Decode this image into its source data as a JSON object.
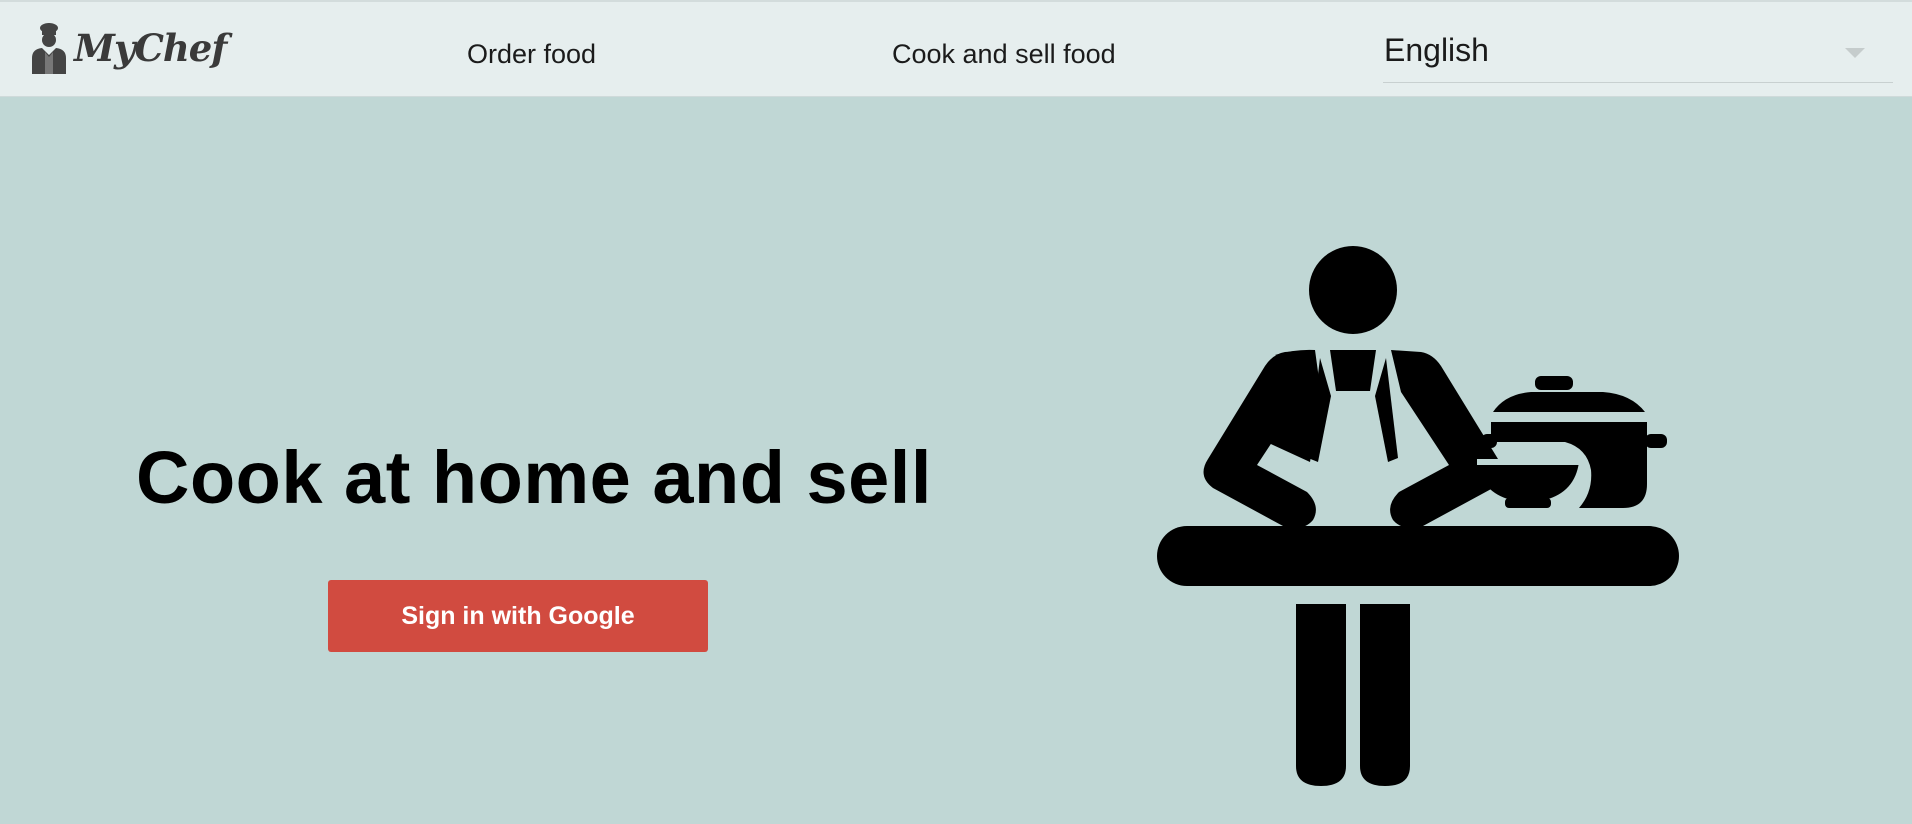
{
  "header": {
    "logo_text": "MyChef",
    "logo_icon": "chef-avatar-icon",
    "nav": {
      "order_food": "Order food",
      "cook_and_sell": "Cook and sell food"
    },
    "language": {
      "selected": "English",
      "caret_icon": "chevron-down-icon"
    }
  },
  "hero": {
    "title": "Cook at home and sell",
    "signin_label": "Sign in with Google",
    "illustration_icon": "chef-cooking-icon"
  },
  "colors": {
    "background": "#c0d7d5",
    "header_background": "#e6eeee",
    "google_button": "#d14b40",
    "text": "#000000"
  }
}
